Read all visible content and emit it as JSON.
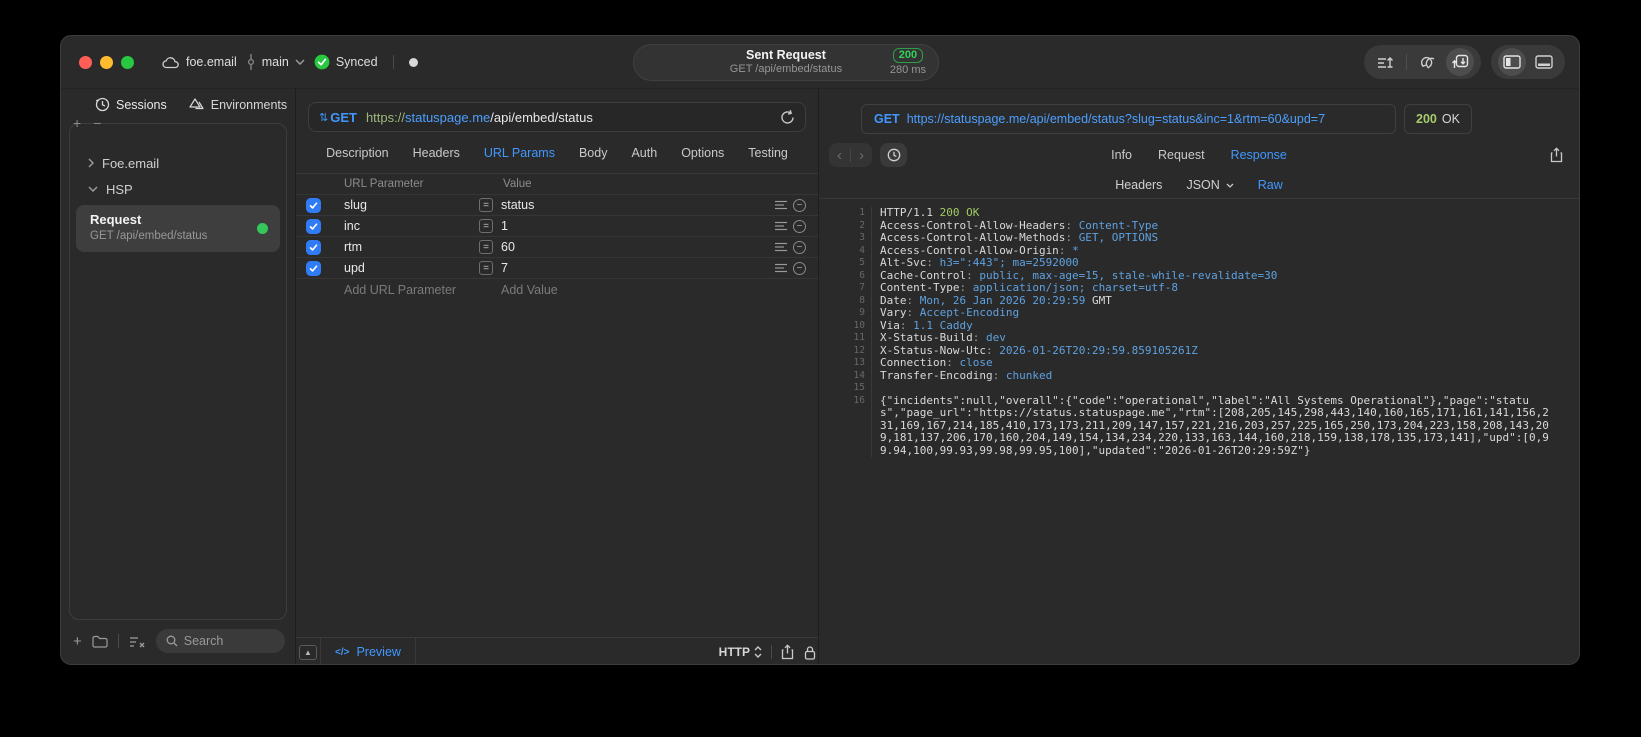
{
  "icons": {
    "plus": "+",
    "minus": "−",
    "updown": "⇅",
    "triangle_up": "▲",
    "code_slash": "</>",
    "back": "‹",
    "forward": "›",
    "dot": ""
  },
  "titlebar": {
    "project": "foe.email",
    "branch": "main",
    "sync_status": "Synced",
    "request_summary": {
      "title": "Sent Request",
      "subtitle": "GET /api/embed/status",
      "status_code": "200",
      "duration": "280 ms"
    }
  },
  "sidebar": {
    "tabs": [
      {
        "label": "Sessions"
      },
      {
        "label": "Environments"
      }
    ],
    "tree": [
      {
        "label": "Foe.email"
      },
      {
        "label": "HSP"
      }
    ],
    "selected_request": {
      "title": "Request",
      "subtitle": "GET /api/embed/status"
    },
    "search_placeholder": "Search"
  },
  "request_editor": {
    "method": "GET",
    "url": {
      "scheme": "https://",
      "host": "statuspage.me",
      "path": "/api/embed/status"
    },
    "tabs": [
      "Description",
      "Headers",
      "URL Params",
      "Body",
      "Auth",
      "Options",
      "Testing"
    ],
    "active_tab": "URL Params",
    "params": {
      "columns": [
        "URL Parameter",
        "Value"
      ],
      "rows": [
        {
          "name": "slug",
          "op": "=",
          "value": "status",
          "enabled": true
        },
        {
          "name": "inc",
          "op": "=",
          "value": "1",
          "enabled": true
        },
        {
          "name": "rtm",
          "op": "=",
          "value": "60",
          "enabled": true
        },
        {
          "name": "upd",
          "op": "=",
          "value": "7",
          "enabled": true
        }
      ],
      "add_name_placeholder": "Add URL Parameter",
      "add_value_placeholder": "Add Value"
    },
    "footer": {
      "preview_label": "Preview",
      "protocol": "HTTP"
    }
  },
  "response_viewer": {
    "request_line": {
      "method": "GET",
      "url": "https://statuspage.me/api/embed/status?slug=status&inc=1&rtm=60&upd=7"
    },
    "status": {
      "code": "200",
      "text": "OK"
    },
    "tabs": [
      "Info",
      "Request",
      "Response"
    ],
    "active_tab": "Response",
    "view_tabs": [
      "Headers",
      "JSON",
      "Raw"
    ],
    "active_view": "Raw",
    "body_lines": [
      {
        "n": "1",
        "seg": [
          {
            "t": "HTTP/1.1 ",
            "c": "p"
          },
          {
            "t": "200 OK",
            "c": "g"
          }
        ]
      },
      {
        "n": "2",
        "seg": [
          {
            "t": "Access-Control-Allow-Headers",
            "c": "p"
          },
          {
            "t": ": ",
            "c": "d"
          },
          {
            "t": "Content-Type",
            "c": "b"
          }
        ]
      },
      {
        "n": "3",
        "seg": [
          {
            "t": "Access-Control-Allow-Methods",
            "c": "p"
          },
          {
            "t": ": ",
            "c": "d"
          },
          {
            "t": "GET, OPTIONS",
            "c": "b"
          }
        ]
      },
      {
        "n": "4",
        "seg": [
          {
            "t": "Access-Control-Allow-Origin",
            "c": "p"
          },
          {
            "t": ": ",
            "c": "d"
          },
          {
            "t": "*",
            "c": "b"
          }
        ]
      },
      {
        "n": "5",
        "seg": [
          {
            "t": "Alt-Svc",
            "c": "p"
          },
          {
            "t": ": ",
            "c": "d"
          },
          {
            "t": "h3=\":443\"; ma=2592000",
            "c": "b"
          }
        ]
      },
      {
        "n": "6",
        "seg": [
          {
            "t": "Cache-Control",
            "c": "p"
          },
          {
            "t": ": ",
            "c": "d"
          },
          {
            "t": "public, max-age=15, stale-while-revalidate=30",
            "c": "b"
          }
        ]
      },
      {
        "n": "7",
        "seg": [
          {
            "t": "Content-Type",
            "c": "p"
          },
          {
            "t": ": ",
            "c": "d"
          },
          {
            "t": "application/json; charset=utf-8",
            "c": "b"
          }
        ]
      },
      {
        "n": "8",
        "seg": [
          {
            "t": "Date",
            "c": "p"
          },
          {
            "t": ": ",
            "c": "d"
          },
          {
            "t": "Mon, 26 Jan 2026 20:29:59",
            "c": "b"
          },
          {
            "t": " GMT",
            "c": "p"
          }
        ]
      },
      {
        "n": "9",
        "seg": [
          {
            "t": "Vary",
            "c": "p"
          },
          {
            "t": ": ",
            "c": "d"
          },
          {
            "t": "Accept-Encoding",
            "c": "b"
          }
        ]
      },
      {
        "n": "10",
        "seg": [
          {
            "t": "Via",
            "c": "p"
          },
          {
            "t": ": ",
            "c": "d"
          },
          {
            "t": "1.1 Caddy",
            "c": "b"
          }
        ]
      },
      {
        "n": "11",
        "seg": [
          {
            "t": "X-Status-Build",
            "c": "p"
          },
          {
            "t": ": ",
            "c": "d"
          },
          {
            "t": "dev",
            "c": "b"
          }
        ]
      },
      {
        "n": "12",
        "seg": [
          {
            "t": "X-Status-Now-Utc",
            "c": "p"
          },
          {
            "t": ": ",
            "c": "d"
          },
          {
            "t": "2026-01-26T20:29:59.859105261Z",
            "c": "b"
          }
        ]
      },
      {
        "n": "13",
        "seg": [
          {
            "t": "Connection",
            "c": "p"
          },
          {
            "t": ": ",
            "c": "d"
          },
          {
            "t": "close",
            "c": "b"
          }
        ]
      },
      {
        "n": "14",
        "seg": [
          {
            "t": "Transfer-Encoding",
            "c": "p"
          },
          {
            "t": ": ",
            "c": "d"
          },
          {
            "t": "chunked",
            "c": "b"
          }
        ]
      },
      {
        "n": "15",
        "seg": []
      },
      {
        "n": "16",
        "seg": [
          {
            "t": "{\"incidents\":null,\"overall\":{\"code\":\"operational\",\"label\":\"All Systems Operational\"},\"page\":\"status\",\"page_url\":\"https://status.statuspage.me\",\"rtm\":[208,205,145,298,443,140,160,165,171,161,141,156,231,169,167,214,185,410,173,173,211,209,147,157,221,216,203,257,225,165,250,173,204,223,158,208,143,209,181,137,206,170,160,204,149,154,134,234,220,133,163,144,160,218,159,138,178,135,173,141],\"upd\":[0,99.94,100,99.93,99.98,99.95,100],\"updated\":\"2026-01-26T20:29:59Z\"}",
            "c": "p"
          }
        ]
      }
    ]
  },
  "colors": {
    "accent_blue": "#4098ff",
    "status_green": "#32d158",
    "token_green": "#a3c964",
    "token_blue": "#5ea1e0",
    "checkbox_blue": "#2f7cf6"
  }
}
